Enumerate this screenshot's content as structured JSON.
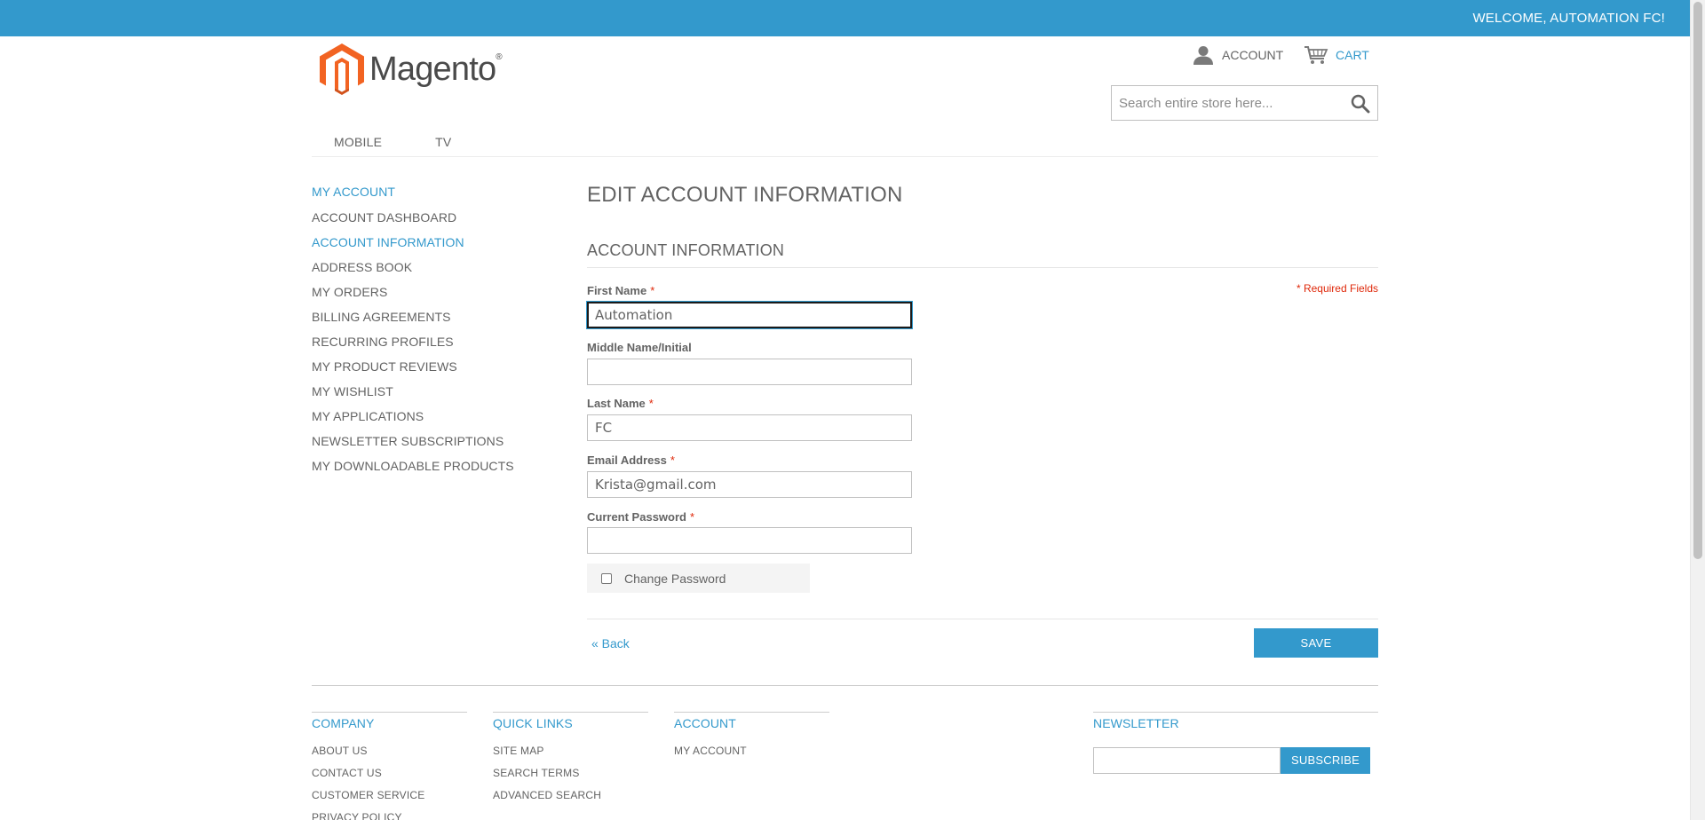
{
  "topbar": {
    "welcome": "WELCOME, AUTOMATION FC!"
  },
  "header": {
    "logo_text": "Magento",
    "logo_reg": "®",
    "account_label": "ACCOUNT",
    "cart_label": "CART",
    "search_placeholder": "Search entire store here..."
  },
  "nav": {
    "items": [
      "MOBILE",
      "TV"
    ]
  },
  "sidebar": {
    "title": "MY ACCOUNT",
    "items": [
      "ACCOUNT DASHBOARD",
      "ACCOUNT INFORMATION",
      "ADDRESS BOOK",
      "MY ORDERS",
      "BILLING AGREEMENTS",
      "RECURRING PROFILES",
      "MY PRODUCT REVIEWS",
      "MY WISHLIST",
      "MY APPLICATIONS",
      "NEWSLETTER SUBSCRIPTIONS",
      "MY DOWNLOADABLE PRODUCTS"
    ],
    "active_item": "ACCOUNT INFORMATION"
  },
  "main": {
    "page_title": "EDIT ACCOUNT INFORMATION",
    "section_title": "ACCOUNT INFORMATION",
    "required_note": "* Required Fields",
    "fields": {
      "first_name": {
        "label": "First Name",
        "value": "Automation",
        "required": "*"
      },
      "middle_name": {
        "label": "Middle Name/Initial",
        "value": ""
      },
      "last_name": {
        "label": "Last Name",
        "value": "FC",
        "required": "*"
      },
      "email": {
        "label": "Email Address",
        "value": "Krista@gmail.com",
        "required": "*"
      },
      "current_password": {
        "label": "Current Password",
        "value": "",
        "required": "*"
      }
    },
    "change_password_label": "Change Password",
    "back_label": "« Back",
    "save_label": "SAVE"
  },
  "footer": {
    "columns": [
      {
        "title": "COMPANY",
        "items": [
          "ABOUT US",
          "CONTACT US",
          "CUSTOMER SERVICE",
          "PRIVACY POLICY"
        ]
      },
      {
        "title": "QUICK LINKS",
        "items": [
          "SITE MAP",
          "SEARCH TERMS",
          "ADVANCED SEARCH"
        ]
      },
      {
        "title": "ACCOUNT",
        "items": [
          "MY ACCOUNT"
        ]
      }
    ],
    "newsletter": {
      "title": "NEWSLETTER",
      "subscribe_label": "SUBSCRIBE"
    }
  },
  "colors": {
    "accent": "#3399cc",
    "required": "#df280a",
    "text": "#636363",
    "logo_orange": "#f26322"
  }
}
